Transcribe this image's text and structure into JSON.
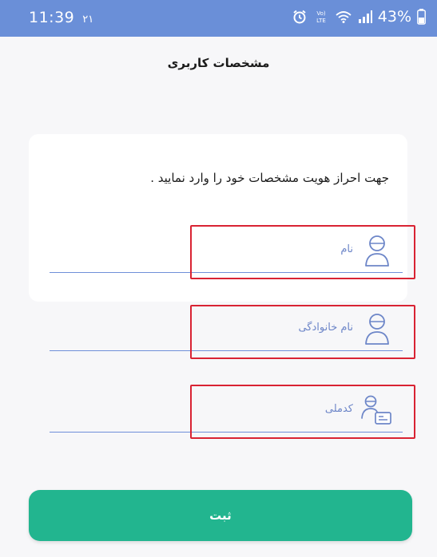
{
  "status_bar": {
    "time": "11:39",
    "notification_count": "۲۱",
    "network_label": "Vo) LTE",
    "battery_percent": "43%",
    "icons": [
      "alarm-icon",
      "volte-icon",
      "wifi-icon",
      "signal-icon",
      "battery-icon"
    ]
  },
  "header": {
    "title": "مشخصات کاربری"
  },
  "form": {
    "instruction": "جهت احراز هویت مشخصات خود را وارد نمایید .",
    "fields": [
      {
        "label": "نام",
        "icon": "user-icon",
        "value": ""
      },
      {
        "label": "نام خانوادگی",
        "icon": "user-icon",
        "value": ""
      },
      {
        "label": "کدملی",
        "icon": "id-card-icon",
        "value": ""
      }
    ],
    "submit_label": "ثبت"
  },
  "colors": {
    "status_bar": "#6a8fd8",
    "accent": "#6f8fd9",
    "button": "#22b58f",
    "highlight": "#d92333",
    "background": "#f7f7f9"
  }
}
